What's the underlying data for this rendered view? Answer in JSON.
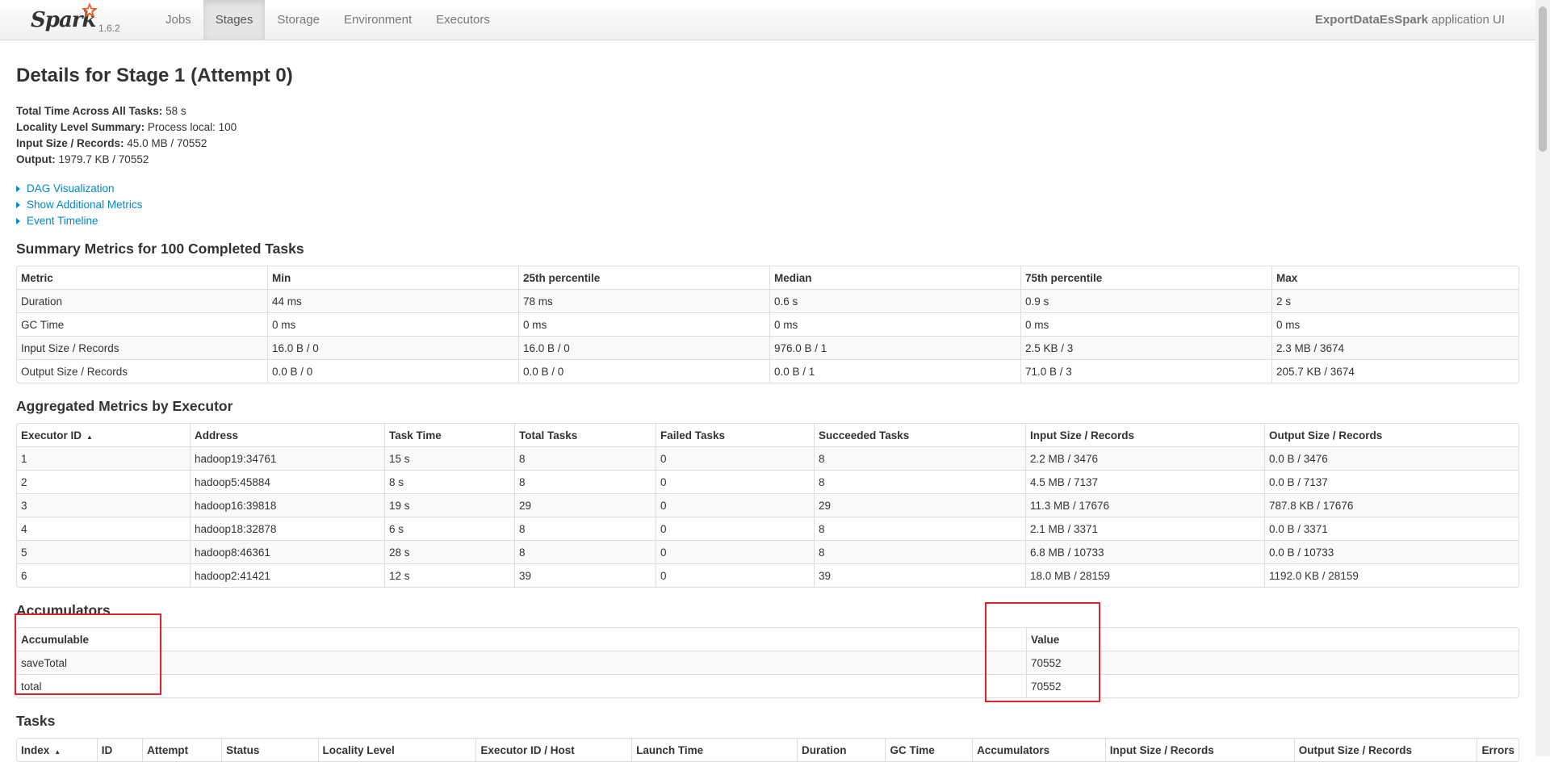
{
  "nav": {
    "brand": "Spark",
    "version": "1.6.2",
    "tabs": [
      "Jobs",
      "Stages",
      "Storage",
      "Environment",
      "Executors"
    ],
    "active_tab": "Stages",
    "app_name_bold": "ExportDataEsSpark",
    "app_name_suffix": "application UI"
  },
  "page_title": "Details for Stage 1 (Attempt 0)",
  "summary": [
    {
      "label": "Total Time Across All Tasks:",
      "value": "58 s"
    },
    {
      "label": "Locality Level Summary:",
      "value": "Process local: 100"
    },
    {
      "label": "Input Size / Records:",
      "value": "45.0 MB / 70552"
    },
    {
      "label": "Output:",
      "value": "1979.7 KB / 70552"
    }
  ],
  "toggles": [
    "DAG Visualization",
    "Show Additional Metrics",
    "Event Timeline"
  ],
  "summary_metrics": {
    "heading": "Summary Metrics for 100 Completed Tasks",
    "columns": [
      "Metric",
      "Min",
      "25th percentile",
      "Median",
      "75th percentile",
      "Max"
    ],
    "rows": [
      [
        "Duration",
        "44 ms",
        "78 ms",
        "0.6 s",
        "0.9 s",
        "2 s"
      ],
      [
        "GC Time",
        "0 ms",
        "0 ms",
        "0 ms",
        "0 ms",
        "0 ms"
      ],
      [
        "Input Size / Records",
        "16.0 B / 0",
        "16.0 B / 0",
        "976.0 B / 1",
        "2.5 KB / 3",
        "2.3 MB / 3674"
      ],
      [
        "Output Size / Records",
        "0.0 B / 0",
        "0.0 B / 0",
        "0.0 B / 1",
        "71.0 B / 3",
        "205.7 KB / 3674"
      ]
    ]
  },
  "executor_metrics": {
    "heading": "Aggregated Metrics by Executor",
    "columns": [
      "Executor ID",
      "Address",
      "Task Time",
      "Total Tasks",
      "Failed Tasks",
      "Succeeded Tasks",
      "Input Size / Records",
      "Output Size / Records"
    ],
    "rows": [
      [
        "1",
        "hadoop19:34761",
        "15 s",
        "8",
        "0",
        "8",
        "2.2 MB / 3476",
        "0.0 B / 3476"
      ],
      [
        "2",
        "hadoop5:45884",
        "8 s",
        "8",
        "0",
        "8",
        "4.5 MB / 7137",
        "0.0 B / 7137"
      ],
      [
        "3",
        "hadoop16:39818",
        "19 s",
        "29",
        "0",
        "29",
        "11.3 MB / 17676",
        "787.8 KB / 17676"
      ],
      [
        "4",
        "hadoop18:32878",
        "6 s",
        "8",
        "0",
        "8",
        "2.1 MB / 3371",
        "0.0 B / 3371"
      ],
      [
        "5",
        "hadoop8:46361",
        "28 s",
        "8",
        "0",
        "8",
        "6.8 MB / 10733",
        "0.0 B / 10733"
      ],
      [
        "6",
        "hadoop2:41421",
        "12 s",
        "39",
        "0",
        "39",
        "18.0 MB / 28159",
        "1192.0 KB / 28159"
      ]
    ]
  },
  "accumulators": {
    "heading": "Accumulators",
    "columns": [
      "Accumulable",
      "Value"
    ],
    "rows": [
      [
        "saveTotal",
        "70552"
      ],
      [
        "total",
        "70552"
      ]
    ]
  },
  "tasks": {
    "heading": "Tasks",
    "columns": [
      "Index",
      "ID",
      "Attempt",
      "Status",
      "Locality Level",
      "Executor ID / Host",
      "Launch Time",
      "Duration",
      "GC Time",
      "Accumulators",
      "Input Size / Records",
      "Output Size / Records",
      "Errors"
    ]
  },
  "colors": {
    "link": "#0088cc",
    "highlight": "#e0242b"
  }
}
